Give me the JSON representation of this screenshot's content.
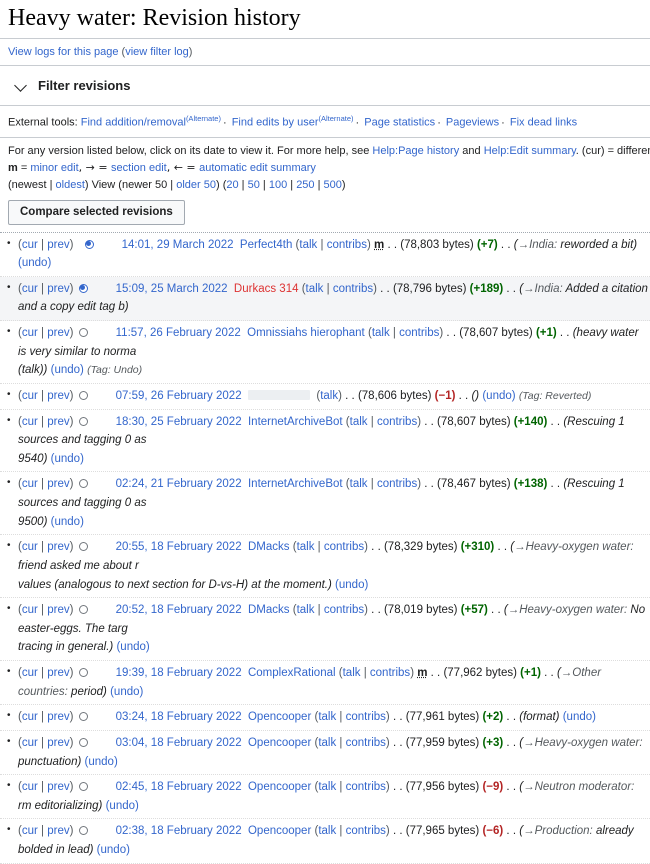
{
  "title": "Heavy water: Revision history",
  "logbar": {
    "view_logs": "View logs for this page",
    "open_paren": "(",
    "view_filter_log": "view filter log",
    "close_paren": ")"
  },
  "filter": {
    "label": "Filter revisions",
    "chevron": "chevron-down-icon"
  },
  "external_tools": {
    "prefix": "External tools:",
    "items": [
      {
        "label": "Find addition/removal",
        "alt": "(Alternate)"
      },
      {
        "label": "Find edits by user",
        "alt": "(Alternate)"
      },
      {
        "label": "Page statistics",
        "alt": ""
      },
      {
        "label": "Pageviews",
        "alt": ""
      },
      {
        "label": "Fix dead links",
        "alt": ""
      }
    ],
    "separator": "·"
  },
  "help": {
    "line1_a": "For any version listed below, click on its date to view it. For more help, see ",
    "link_page_history": "Help:Page history",
    "line1_b": " and ",
    "link_edit_summary": "Help:Edit summary",
    "line1_c": ". (cur) = difference from current v",
    "line2_m": "m",
    "line2_a": " = ",
    "line2_minor": "minor edit",
    "line2_b": ", → = ",
    "line2_section": "section edit",
    "line2_c": ", ← = ",
    "line2_auto": "automatic edit summary"
  },
  "nav": {
    "open": "(",
    "newest": "newest",
    "bar1": " | ",
    "oldest": "oldest",
    "close_view": ") View (",
    "newer50": "newer 50",
    "bar2": " | ",
    "older50": "older 50",
    "mid": ") (",
    "n20": "20",
    "n50": "50",
    "n100": "100",
    "n250": "250",
    "n500": "500",
    "end": ")"
  },
  "compare_button": "Compare selected revisions",
  "labels": {
    "cur": "cur",
    "prev": "prev",
    "pipe": " | ",
    "talk": "talk",
    "contribs": "contribs",
    "undo": "undo",
    "dots": " . . ",
    "open_paren": "(",
    "close_paren": ")"
  },
  "revisions": [
    {
      "radio": "selected",
      "radio_indent": true,
      "timestamp": "14:01, 29 March 2022",
      "user": "Perfect4th",
      "user_red": false,
      "user_redacted": false,
      "has_contribs": true,
      "minor": "m",
      "bytes": "(78,803 bytes)",
      "delta": "(+7)",
      "delta_sign": "pos",
      "section": "→India:",
      "comment": " reworded a bit",
      "has_undo": true,
      "tag": "",
      "selected_row": false,
      "extra_line": ""
    },
    {
      "radio": "selected",
      "radio_indent": false,
      "timestamp": "15:09, 25 March 2022",
      "user": "Durkacs 314",
      "user_red": true,
      "user_redacted": false,
      "has_contribs": true,
      "minor": "",
      "bytes": "(78,796 bytes)",
      "delta": "(+189)",
      "delta_sign": "pos",
      "section": "→India:",
      "comment": " Added a citation and a copy edit tag b",
      "has_undo": false,
      "tag": "",
      "selected_row": true,
      "extra_line": ""
    },
    {
      "radio": "empty",
      "radio_indent": false,
      "timestamp": "11:57, 26 February 2022",
      "user": "Omnissiahs hierophant",
      "user_red": false,
      "user_redacted": false,
      "has_contribs": true,
      "minor": "",
      "bytes": "(78,607 bytes)",
      "delta": "(+1)",
      "delta_sign": "pos",
      "section": "",
      "comment": "heavy water is very similar to norma",
      "has_undo": false,
      "tag": "",
      "selected_row": false,
      "extra_line": "wrap_talk_undo_tag"
    },
    {
      "radio": "empty",
      "radio_indent": false,
      "timestamp": "07:59, 26 February 2022",
      "user": "",
      "user_red": false,
      "user_redacted": true,
      "has_contribs": false,
      "minor": "",
      "bytes": "(78,606 bytes)",
      "delta": "(−1)",
      "delta_sign": "neg",
      "section": "",
      "comment": "",
      "has_undo": true,
      "tag": "(Tag: Reverted)",
      "selected_row": false,
      "extra_line": ""
    },
    {
      "radio": "empty",
      "radio_indent": false,
      "timestamp": "18:30, 25 February 2022",
      "user": "InternetArchiveBot",
      "user_red": false,
      "user_redacted": false,
      "has_contribs": true,
      "minor": "",
      "bytes": "(78,607 bytes)",
      "delta": "(+140)",
      "delta_sign": "pos",
      "section": "",
      "comment": "Rescuing 1 sources and tagging 0 as",
      "has_undo": false,
      "tag": "",
      "selected_row": false,
      "extra_line": "wrap_9540"
    },
    {
      "radio": "empty",
      "radio_indent": false,
      "timestamp": "02:24, 21 February 2022",
      "user": "InternetArchiveBot",
      "user_red": false,
      "user_redacted": false,
      "has_contribs": true,
      "minor": "",
      "bytes": "(78,467 bytes)",
      "delta": "(+138)",
      "delta_sign": "pos",
      "section": "",
      "comment": "Rescuing 1 sources and tagging 0 as",
      "has_undo": false,
      "tag": "",
      "selected_row": false,
      "extra_line": "wrap_9500"
    },
    {
      "radio": "empty",
      "radio_indent": false,
      "timestamp": "20:55, 18 February 2022",
      "user": "DMacks",
      "user_red": false,
      "user_redacted": false,
      "has_contribs": true,
      "minor": "",
      "bytes": "(78,329 bytes)",
      "delta": "(+310)",
      "delta_sign": "pos",
      "section": "→Heavy-oxygen water:",
      "comment": " friend asked me about r",
      "has_undo": false,
      "tag": "",
      "selected_row": false,
      "extra_line": "wrap_dmacks1"
    },
    {
      "radio": "empty",
      "radio_indent": false,
      "timestamp": "20:52, 18 February 2022",
      "user": "DMacks",
      "user_red": false,
      "user_redacted": false,
      "has_contribs": true,
      "minor": "",
      "bytes": "(78,019 bytes)",
      "delta": "(+57)",
      "delta_sign": "pos",
      "section": "→Heavy-oxygen water:",
      "comment": " No easter-eggs. The targ",
      "has_undo": false,
      "tag": "",
      "selected_row": false,
      "extra_line": "wrap_dmacks2"
    },
    {
      "radio": "empty",
      "radio_indent": false,
      "timestamp": "19:39, 18 February 2022",
      "user": "ComplexRational",
      "user_red": false,
      "user_redacted": false,
      "has_contribs": true,
      "minor": "m",
      "bytes": "(77,962 bytes)",
      "delta": "(+1)",
      "delta_sign": "pos",
      "section": "→Other countries:",
      "comment": " period",
      "has_undo": true,
      "tag": "",
      "selected_row": false,
      "extra_line": ""
    },
    {
      "radio": "empty",
      "radio_indent": false,
      "timestamp": "03:24, 18 February 2022",
      "user": "Opencooper",
      "user_red": false,
      "user_redacted": false,
      "has_contribs": true,
      "minor": "",
      "bytes": "(77,961 bytes)",
      "delta": "(+2)",
      "delta_sign": "pos",
      "section": "",
      "comment": "format",
      "has_undo": true,
      "tag": "",
      "selected_row": false,
      "extra_line": ""
    },
    {
      "radio": "empty",
      "radio_indent": false,
      "timestamp": "03:04, 18 February 2022",
      "user": "Opencooper",
      "user_red": false,
      "user_redacted": false,
      "has_contribs": true,
      "minor": "",
      "bytes": "(77,959 bytes)",
      "delta": "(+3)",
      "delta_sign": "pos",
      "section": "→Heavy-oxygen water:",
      "comment": " punctuation",
      "has_undo": true,
      "tag": "",
      "selected_row": false,
      "extra_line": ""
    },
    {
      "radio": "empty",
      "radio_indent": false,
      "timestamp": "02:45, 18 February 2022",
      "user": "Opencooper",
      "user_red": false,
      "user_redacted": false,
      "has_contribs": true,
      "minor": "",
      "bytes": "(77,956 bytes)",
      "delta": "(−9)",
      "delta_sign": "neg",
      "section": "→Neutron moderator:",
      "comment": " rm editorializing",
      "has_undo": true,
      "tag": "",
      "selected_row": false,
      "extra_line": ""
    },
    {
      "radio": "empty",
      "radio_indent": false,
      "timestamp": "02:38, 18 February 2022",
      "user": "Opencooper",
      "user_red": false,
      "user_redacted": false,
      "has_contribs": true,
      "minor": "",
      "bytes": "(77,965 bytes)",
      "delta": "(−6)",
      "delta_sign": "neg",
      "section": "→Production:",
      "comment": " already bolded in lead",
      "has_undo": true,
      "tag": "",
      "selected_row": false,
      "extra_line": ""
    }
  ],
  "wrapped_lines": {
    "wrap_talk_undo_tag_talk": "(talk))",
    "wrap_talk_undo_tag_undo": "(undo)",
    "wrap_talk_undo_tag_tag": "(Tag: Undo)",
    "wrap_9540": "9540)",
    "wrap_9500": "9500)",
    "wrap_undo": "(undo)",
    "wrap_dmacks1": "values (analogous to next section for D-vs-H) at the moment.)",
    "wrap_dmacks2": "tracing in general.)"
  },
  "colors": {
    "link": "#3366cc",
    "redlink": "#d33",
    "positive": "#006400",
    "negative": "#b32424",
    "selected_row_bg": "#f4f5f7",
    "rule": "#c8ccd1"
  }
}
